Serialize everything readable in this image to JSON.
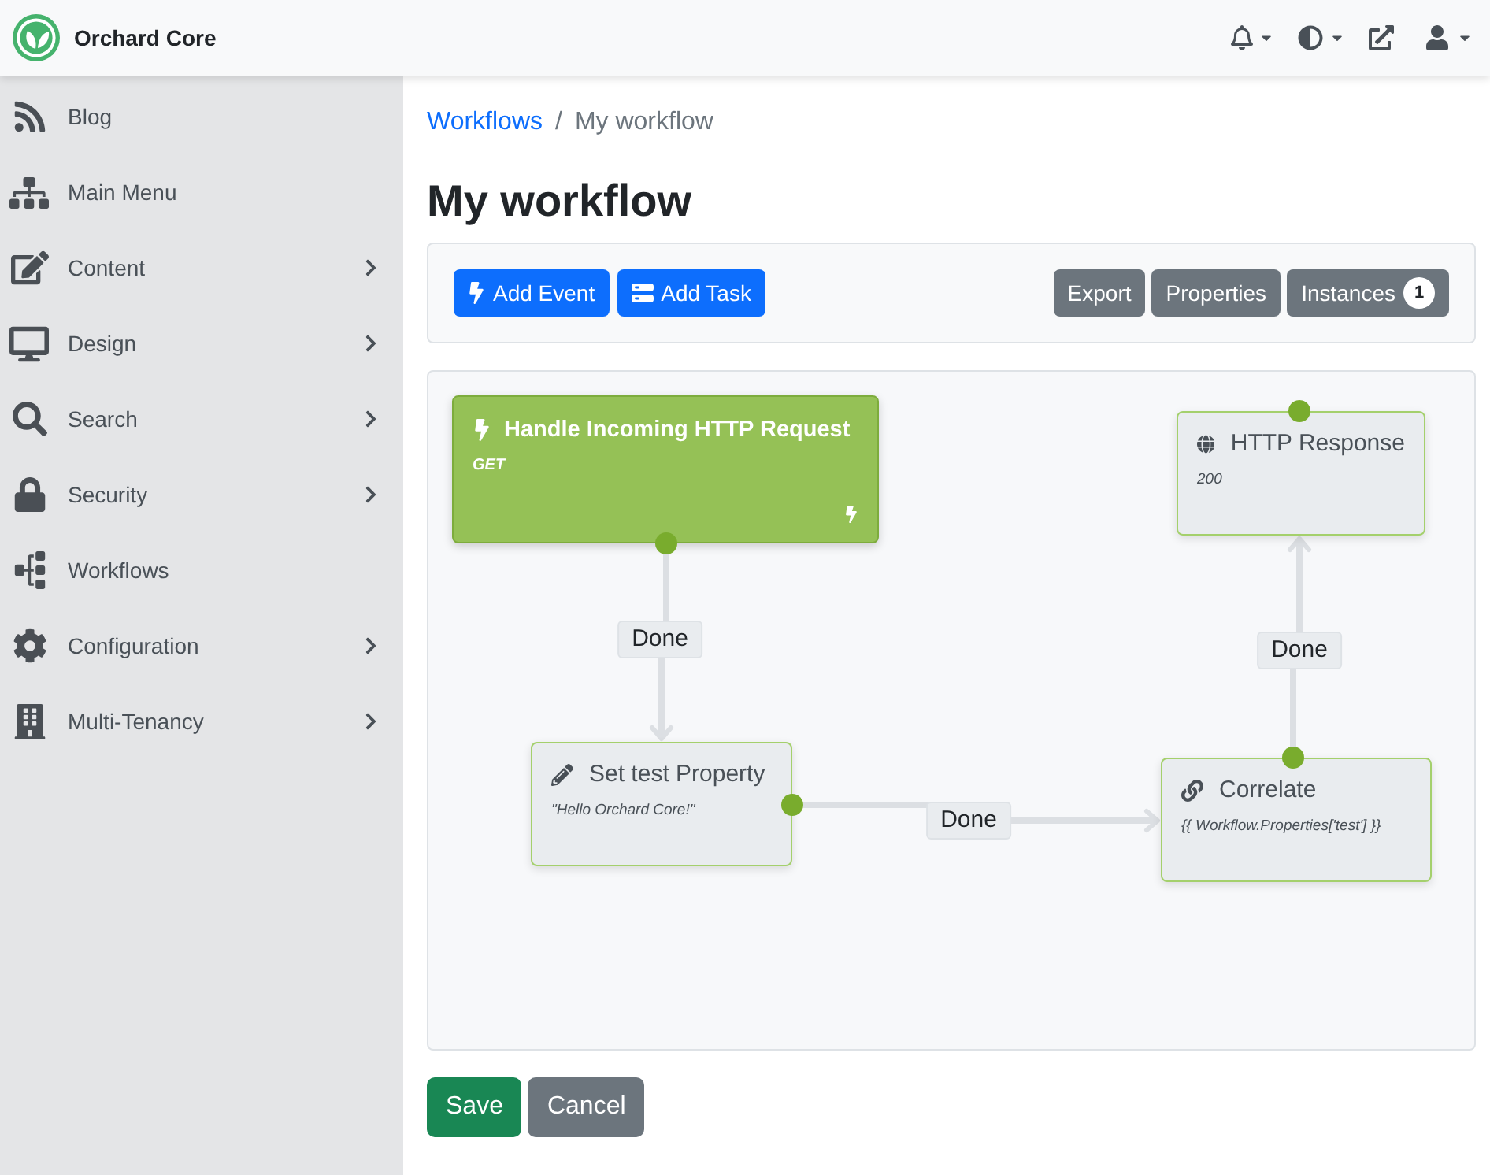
{
  "header": {
    "brand": "Orchard Core"
  },
  "sidebar": {
    "items": [
      {
        "label": "Blog",
        "submenu": false
      },
      {
        "label": "Main Menu",
        "submenu": false
      },
      {
        "label": "Content",
        "submenu": true
      },
      {
        "label": "Design",
        "submenu": true
      },
      {
        "label": "Search",
        "submenu": true
      },
      {
        "label": "Security",
        "submenu": true
      },
      {
        "label": "Workflows",
        "submenu": false
      },
      {
        "label": "Configuration",
        "submenu": true
      },
      {
        "label": "Multi-Tenancy",
        "submenu": true
      }
    ]
  },
  "breadcrumb": {
    "items": [
      {
        "label": "Workflows",
        "current": false
      },
      {
        "label": "My workflow",
        "current": true
      }
    ],
    "separator": "/"
  },
  "title": "My workflow",
  "toolbar": {
    "left_buttons": [
      {
        "label": "Add Event"
      },
      {
        "label": "Add Task"
      }
    ],
    "right_buttons": [
      {
        "label": "Export"
      },
      {
        "label": "Properties"
      },
      {
        "label": "Instances",
        "badge": "1"
      }
    ]
  },
  "canvas": {
    "activities": [
      {
        "kind": "event",
        "title": "Handle Incoming HTTP Request",
        "detail": "GET"
      },
      {
        "kind": "task",
        "title": "HTTP Response",
        "detail": "200"
      },
      {
        "kind": "task",
        "title": "Set test Property",
        "detail": "\"Hello Orchard Core!\""
      },
      {
        "kind": "task",
        "title": "Correlate",
        "detail": "{{ Workflow.Properties['test'] }}"
      }
    ],
    "connections": [
      {
        "label": "Done"
      },
      {
        "label": "Done"
      },
      {
        "label": "Done"
      }
    ]
  },
  "actions": [
    {
      "label": "Save",
      "kind": "primary"
    },
    {
      "label": "Cancel",
      "kind": "secondary"
    }
  ]
}
